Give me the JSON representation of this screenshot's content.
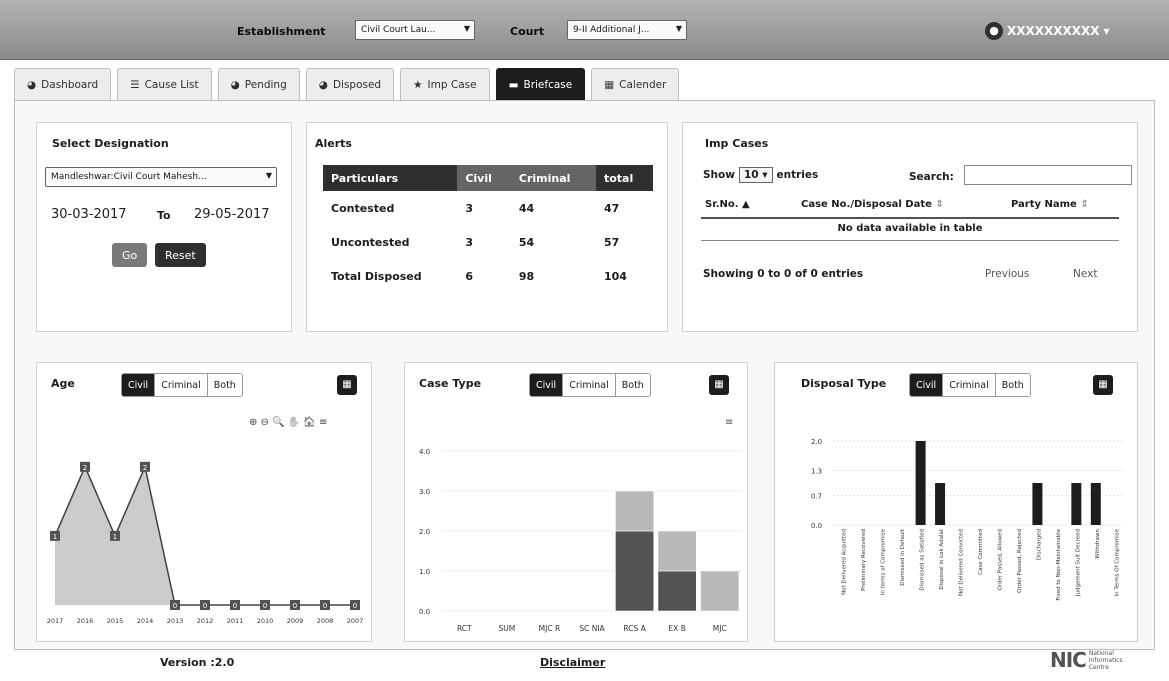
{
  "header": {
    "establishment_label": "Establishment",
    "establishment_value": "Civil Court Lau...",
    "court_label": "Court",
    "court_value": "9-II Additional J...",
    "user_name": "XXXXXXXXXX"
  },
  "tabs": [
    {
      "label": "Dashboard",
      "icon": "dashboard-icon"
    },
    {
      "label": "Cause List",
      "icon": "list-icon"
    },
    {
      "label": "Pending",
      "icon": "gauge-icon"
    },
    {
      "label": "Disposed",
      "icon": "gauge-icon"
    },
    {
      "label": "Imp Case",
      "icon": "star-icon"
    },
    {
      "label": "Briefcase",
      "icon": "briefcase-icon"
    },
    {
      "label": "Calender",
      "icon": "calendar-icon"
    }
  ],
  "designation": {
    "title": "Select Designation",
    "value": "Mandleshwar:Civil Court Mahesh...",
    "from": "30-03-2017",
    "to_label": "To",
    "to": "29-05-2017",
    "go": "Go",
    "reset": "Reset"
  },
  "alerts": {
    "title": "Alerts",
    "headers": [
      "Particulars",
      "Civil",
      "Criminal",
      "total"
    ],
    "rows": [
      [
        "Contested",
        "3",
        "44",
        "47"
      ],
      [
        "Uncontested",
        "3",
        "54",
        "57"
      ],
      [
        "Total Disposed",
        "6",
        "98",
        "104"
      ]
    ]
  },
  "imp_cases": {
    "title": "Imp Cases",
    "show_label": "Show",
    "entries_value": "10",
    "entries_label": "entries",
    "search_label": "Search:",
    "columns": [
      "Sr.No.",
      "Case No./Disposal Date",
      "Party Name"
    ],
    "empty": "No data available in table",
    "info": "Showing 0 to 0 of 0 entries",
    "previous": "Previous",
    "next": "Next"
  },
  "filters": [
    "Civil",
    "Criminal",
    "Both"
  ],
  "age_chart": {
    "title": "Age",
    "tools": "⊕ ⊖ 🔍 ✋ 🏠 ≡"
  },
  "case_type_chart": {
    "title": "Case Type"
  },
  "disposal_chart": {
    "title": "Disposal Type"
  },
  "chart_data": [
    {
      "type": "area",
      "title": "Age",
      "x": [
        "2017",
        "2016",
        "2015",
        "2014",
        "2013",
        "2012",
        "2011",
        "2010",
        "2009",
        "2008",
        "2007"
      ],
      "values": [
        1,
        2,
        1,
        2,
        0,
        0,
        0,
        0,
        0,
        0,
        0
      ],
      "point_labels": [
        "1",
        "2",
        "1",
        "2",
        "0",
        "0",
        "0",
        "0",
        "0",
        "0",
        "0"
      ]
    },
    {
      "type": "bar",
      "title": "Case Type",
      "categories": [
        "RCT",
        "SUM",
        "MJC R",
        "SC NIA",
        "RCS A",
        "EX B",
        "MJC"
      ],
      "yticks": [
        "0.0",
        "1.0",
        "2.0",
        "3.0",
        "4.0"
      ],
      "ylim": [
        0,
        4
      ],
      "series": [
        {
          "values": [
            0,
            0,
            0,
            0,
            2,
            1,
            0
          ],
          "color": "#555555"
        },
        {
          "values": [
            0,
            0,
            0,
            0,
            1,
            1,
            1
          ],
          "color": "#b5b5b5"
        }
      ]
    },
    {
      "type": "bar",
      "title": "Disposal Type",
      "yticks": [
        "0.0",
        "0.7",
        "1.3",
        "2.0"
      ],
      "ylim": [
        0,
        2
      ],
      "categories": [
        "Not Delivered Acquitted",
        "Preliminary Recovered",
        "In terms of Compromise",
        "Dismissed in Default",
        "Dismissed as Satisfied",
        "Disposal in Lok Adalat",
        "Not Delivered Convicted",
        "Case Committed",
        "Order Passed, Allowed",
        "Order Passed, Rejected",
        "Discharged",
        "Fixed to Non-Maintainable",
        "Judgement Suit Decreed",
        "Withdrawn",
        "In Terms Of Compromise"
      ],
      "values": [
        0,
        0,
        0,
        0,
        2,
        1,
        0,
        0,
        0,
        0,
        1,
        0,
        1,
        1,
        0
      ]
    }
  ],
  "footer": {
    "version": "Version :2.0",
    "disclaimer": "Disclaimer",
    "nic": "NIC",
    "nic_sub": "National Informatics Centre"
  }
}
